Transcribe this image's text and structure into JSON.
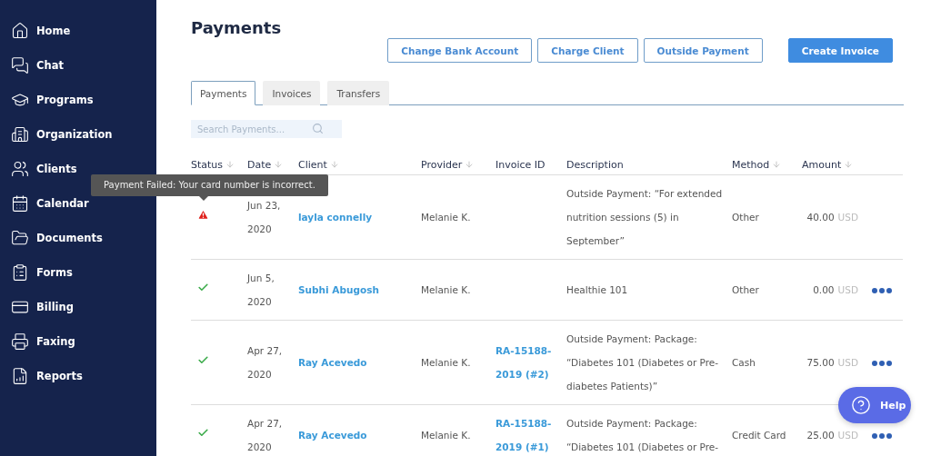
{
  "sidebar": {
    "items": [
      {
        "label": "Home",
        "selected": false
      },
      {
        "label": "Chat",
        "selected": false
      },
      {
        "label": "Programs",
        "selected": false
      },
      {
        "label": "Organization",
        "selected": false
      },
      {
        "label": "Clients",
        "selected": false
      },
      {
        "label": "Calendar",
        "selected": false
      },
      {
        "label": "Documents",
        "selected": false
      },
      {
        "label": "Forms",
        "selected": false
      },
      {
        "label": "Billing",
        "selected": false
      },
      {
        "label": "Faxing",
        "selected": false
      },
      {
        "label": "Reports",
        "selected": false
      }
    ]
  },
  "page": {
    "title": "Payments"
  },
  "actions": [
    {
      "label": "Change Bank Account",
      "kind": "outline"
    },
    {
      "label": "Charge Client",
      "kind": "outline"
    },
    {
      "label": "Outside Payment",
      "kind": "outline"
    },
    {
      "label": "Create Invoice",
      "kind": "primary"
    }
  ],
  "tabs": [
    {
      "label": "Payments",
      "selected": true
    },
    {
      "label": "Invoices",
      "selected": false
    },
    {
      "label": "Transfers",
      "selected": false
    }
  ],
  "search": {
    "placeholder": "Search Payments..."
  },
  "table": {
    "columns": [
      {
        "label": "Status",
        "sortable": true
      },
      {
        "label": "Date",
        "sortable": true
      },
      {
        "label": "Client",
        "sortable": true
      },
      {
        "label": "Provider",
        "sortable": true
      },
      {
        "label": "Invoice ID",
        "sortable": false
      },
      {
        "label": "Description",
        "sortable": false
      },
      {
        "label": "Method",
        "sortable": true
      },
      {
        "label": "Amount",
        "sortable": true
      }
    ],
    "rows": [
      {
        "kind": "failed",
        "date": "Jun 23, 2020",
        "client": "layla connelly",
        "provider": "Melanie K.",
        "description": "Outside Payment: “For extended nutrition sessions (5) in September”",
        "method": "Other",
        "amount": "40.00",
        "currency": "USD",
        "has_menu": false
      },
      {
        "kind": "success",
        "date": "Jun 5, 2020",
        "client": "Subhi Abugosh",
        "provider": "Melanie K.",
        "description": "Healthie 101",
        "method": "Other",
        "amount": "0.00",
        "currency": "USD",
        "has_menu": true
      },
      {
        "kind": "success",
        "date": "Apr 27, 2020",
        "client": "Ray Acevedo",
        "provider": "Melanie K.",
        "invoice_id": "RA-15188-2019 (#2)",
        "description": "Outside Payment: Package: “Diabetes 101 (Diabetes or Pre-diabetes Patients)”",
        "method": "Cash",
        "amount": "75.00",
        "currency": "USD",
        "has_menu": true
      },
      {
        "kind": "success",
        "date": "Apr 27, 2020",
        "client": "Ray Acevedo",
        "provider": "Melanie K.",
        "invoice_id": "RA-15188-2019 (#1)",
        "description": "Outside Payment: Package: “Diabetes 101 (Diabetes or Pre-",
        "method": "Credit Card",
        "amount": "25.00",
        "currency": "USD",
        "has_menu": true
      }
    ]
  },
  "tooltip": {
    "text": "Payment Failed: Your card number is incorrect."
  },
  "help": {
    "label": "Help"
  }
}
